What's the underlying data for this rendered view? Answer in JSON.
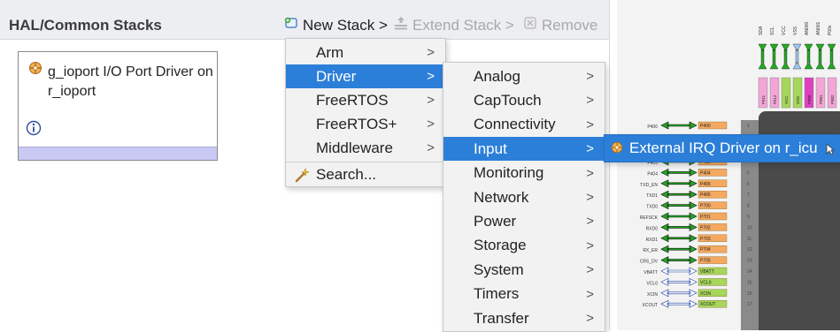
{
  "panel": {
    "title": "HAL/Common Stacks"
  },
  "toolbar": {
    "new_stack": "New Stack >",
    "extend_stack": "Extend Stack >",
    "remove": "Remove"
  },
  "stack_card": {
    "title": "g_ioport I/O Port Driver on r_ioport"
  },
  "menu_new_stack": {
    "items": [
      {
        "label": "Arm",
        "submenu": true,
        "selected": false
      },
      {
        "label": "Driver",
        "submenu": true,
        "selected": true
      },
      {
        "label": "FreeRTOS",
        "submenu": true,
        "selected": false
      },
      {
        "label": "FreeRTOS+",
        "submenu": true,
        "selected": false
      },
      {
        "label": "Middleware",
        "submenu": true,
        "selected": false
      },
      {
        "label": "Search...",
        "submenu": false,
        "selected": false
      }
    ]
  },
  "menu_driver": {
    "items": [
      {
        "label": "Analog",
        "selected": false
      },
      {
        "label": "CapTouch",
        "selected": false
      },
      {
        "label": "Connectivity",
        "selected": false
      },
      {
        "label": "Input",
        "selected": true
      },
      {
        "label": "Monitoring",
        "selected": false
      },
      {
        "label": "Network",
        "selected": false
      },
      {
        "label": "Power",
        "selected": false
      },
      {
        "label": "Storage",
        "selected": false
      },
      {
        "label": "System",
        "selected": false
      },
      {
        "label": "Timers",
        "selected": false
      },
      {
        "label": "Transfer",
        "selected": false
      }
    ]
  },
  "menu_input": {
    "items": [
      {
        "label": "External IRQ Driver on r_icu"
      }
    ]
  },
  "pin_diagram": {
    "top_pins": [
      "SDA",
      "SCL",
      "VCC",
      "VSS",
      "AN000",
      "AN001",
      "P00x"
    ],
    "top_boxes": [
      "P511",
      "P512",
      "VCC",
      "VSS",
      "P000",
      "P001",
      "P002"
    ],
    "left_pins": [
      {
        "label": "P400",
        "box": "P400",
        "num": "1"
      },
      {
        "label": "P403",
        "box": "P403",
        "num": "4"
      },
      {
        "label": "P404",
        "box": "P404",
        "num": "5"
      },
      {
        "label": "TXD_EN",
        "box": "P405",
        "num": "6"
      },
      {
        "label": "TXD1",
        "box": "P406",
        "num": "7"
      },
      {
        "label": "TXD0",
        "box": "P700",
        "num": "8"
      },
      {
        "label": "REFSCK",
        "box": "P701",
        "num": "9"
      },
      {
        "label": "RXD0",
        "box": "P702",
        "num": "10"
      },
      {
        "label": "RXD1",
        "box": "P703",
        "num": "11"
      },
      {
        "label": "RX_ER",
        "box": "P704",
        "num": "12"
      },
      {
        "label": "CRS_DV",
        "box": "P705",
        "num": "13"
      },
      {
        "label": "VBATT",
        "box": "VBATT",
        "num": "14"
      },
      {
        "label": "VCL0",
        "box": "VCL0",
        "num": "15"
      },
      {
        "label": "XCIN",
        "box": "XCIN",
        "num": "16"
      },
      {
        "label": "XCOUT",
        "box": "XCOUT",
        "num": "17"
      }
    ],
    "colors": {
      "box_orange": "#f4a860",
      "box_green": "#a6d65a",
      "box_pink": "#f2a6d6",
      "box_magenta": "#e040c0",
      "arrow_green": "#22aa22",
      "chip": "#4a4a4a"
    }
  },
  "colors": {
    "selection": "#2c7fd8",
    "header_bg": "#eceef2",
    "card_bar": "#c9c9f3",
    "menu_bg": "#f2f2f2"
  }
}
